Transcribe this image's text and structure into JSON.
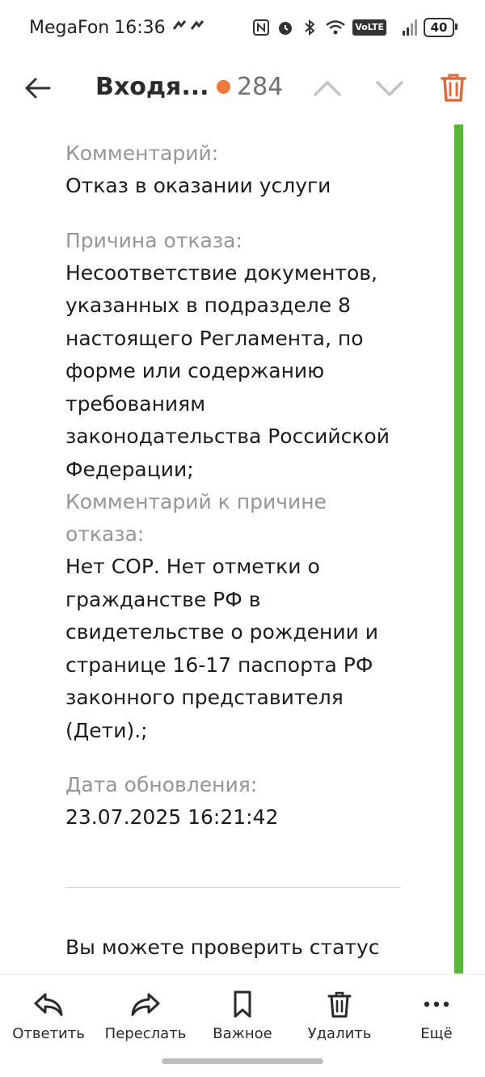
{
  "status_bar": {
    "carrier": "MegaFon",
    "time": "16:36",
    "network": "4G",
    "volte": "VoLTE",
    "battery": "40"
  },
  "nav": {
    "folder_title": "Входя...",
    "unread_count": "284",
    "accent_color": "#f07a3e"
  },
  "message": {
    "sections": [
      {
        "label": "Комментарий:",
        "value_lines": [
          "Отказ в оказании услуги"
        ]
      },
      {
        "label": "Причина отказа:",
        "value_lines": [
          "Несоответствие документов,",
          "указанных в подразделе 8",
          "настоящего Регламента, по",
          "форме или содержанию",
          "требованиям",
          "законодательства Российской",
          "Федерации;"
        ]
      },
      {
        "label_lines": [
          "Комментарий к причине",
          "отказа:"
        ],
        "value_lines": [
          "Нет СОР. Нет отметки о",
          "гражданстве РФ в",
          "свидетельстве о рождении и",
          "странице 16-17 паспорта РФ",
          "законного представителя",
          "(Дети).;"
        ]
      },
      {
        "label": "Дата обновления:",
        "value_lines": [
          "23.07.2025 16:21:42"
        ]
      }
    ],
    "after_divider_text": "Вы можете проверить статус"
  },
  "toolbar": {
    "reply": "Ответить",
    "forward": "Переслать",
    "important": "Важное",
    "delete": "Удалить",
    "more": "Ещё"
  },
  "colors": {
    "status_line": "#58b73a",
    "delete_icon": "#e06a3b"
  }
}
